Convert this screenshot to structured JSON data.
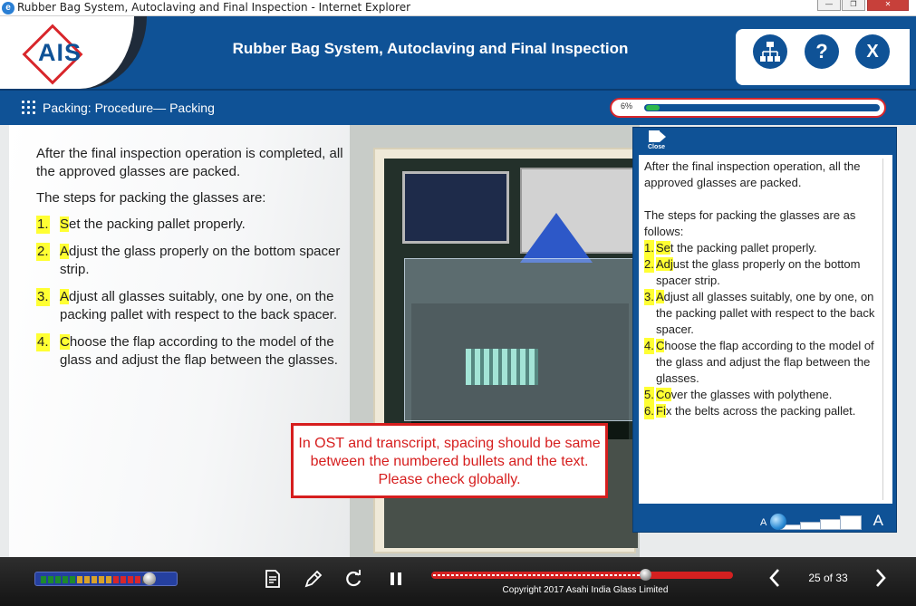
{
  "window": {
    "title": "Rubber Bag System, Autoclaving and Final Inspection - Internet Explorer",
    "minimize": "—",
    "maximize": "❐",
    "close": "✕"
  },
  "header": {
    "logo_text": "AIS",
    "title": "Rubber Bag System, Autoclaving and Final Inspection",
    "buttons": {
      "menu_icon": "sitemap-icon",
      "help_label": "?",
      "exit_label": "X"
    }
  },
  "subheader": {
    "breadcrumb": "Packing: Procedure— Packing",
    "progress_label": "6%",
    "progress_fraction": 0.06
  },
  "content": {
    "intro": "After the final inspection operation is completed, all the approved glasses are packed.",
    "steps_heading": "The steps for packing the glasses are:",
    "steps": [
      {
        "num": "1.",
        "first": "S",
        "rest": "et the packing pallet properly."
      },
      {
        "num": "2.",
        "first": "A",
        "rest": "djust the glass properly on the bottom spacer strip."
      },
      {
        "num": "3.",
        "first": "A",
        "rest": "djust all glasses suitably, one by one, on the packing pallet with respect to the back spacer."
      },
      {
        "num": "4.",
        "first": "C",
        "rest": "hoose the flap according to the model of the glass and adjust the flap between the glasses."
      }
    ]
  },
  "ost": {
    "close_label": "Close",
    "para1": "After the final inspection operation, all the approved glasses are packed.",
    "para2": "The steps for packing the glasses are as follows:",
    "items": [
      {
        "num": "1. ",
        "hl": "Se",
        "rest": "t the packing pallet properly."
      },
      {
        "num": "2. ",
        "hl": "Adj",
        "rest": "ust the glass properly on the bottom spacer strip."
      },
      {
        "num": "3. ",
        "hl": "A",
        "rest": "djust all glasses suitably, one by one, on the packing pallet with respect to the back spacer."
      },
      {
        "num": "4. ",
        "hl": "C",
        "rest": "hoose the flap according to the model of the glass and adjust the flap between the glasses."
      },
      {
        "num": "5. ",
        "hl": "Co",
        "rest": "ver the glasses with polythene."
      },
      {
        "num": "6. ",
        "hl": "Fi",
        "rest": "x the belts across the packing pallet."
      }
    ],
    "font_small": "A",
    "font_large": "A"
  },
  "review_note": "In OST and transcript, spacing should be same between the numbered bullets and the text. Please check globally.",
  "footer": {
    "copyright": "Copyright 2017 Asahi India Glass Limited",
    "page_indicator": "25 of 33",
    "prev_icon": "chevron-left-icon",
    "next_icon": "chevron-right-icon",
    "seek_fraction": 0.71,
    "volume_fraction": 0.88
  },
  "colors": {
    "brand_blue": "#0f5296",
    "brand_red": "#d8262b",
    "highlight": "#ffff33",
    "progress_green": "#2eb84c"
  }
}
